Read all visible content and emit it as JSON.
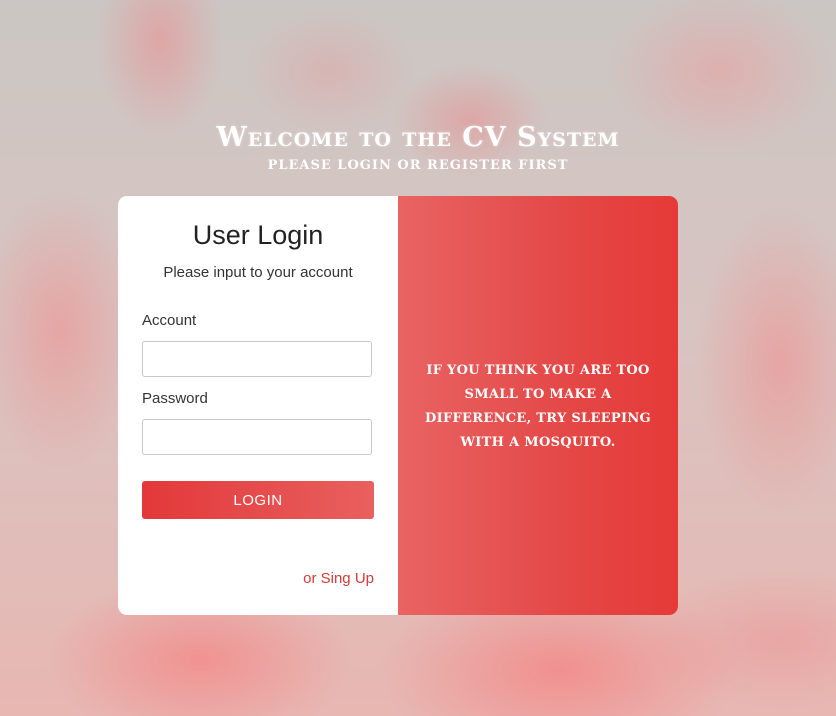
{
  "header": {
    "title": "Welcome to the CV System",
    "subtitle": "Please login or register first"
  },
  "login": {
    "title": "User Login",
    "subtitle": "Please input to your account",
    "account_label": "Account",
    "account_value": "",
    "password_label": "Password",
    "password_value": "",
    "button_label": "LOGIN",
    "signup_label": "or Sing Up"
  },
  "quote": {
    "text": "If You think You are too small to make a difference, try sleeping with a mosquito."
  },
  "colors": {
    "accent": "#e53a38",
    "link": "#d43b39",
    "panel_gradient_start": "#e86463",
    "panel_gradient_end": "#e53a38"
  }
}
